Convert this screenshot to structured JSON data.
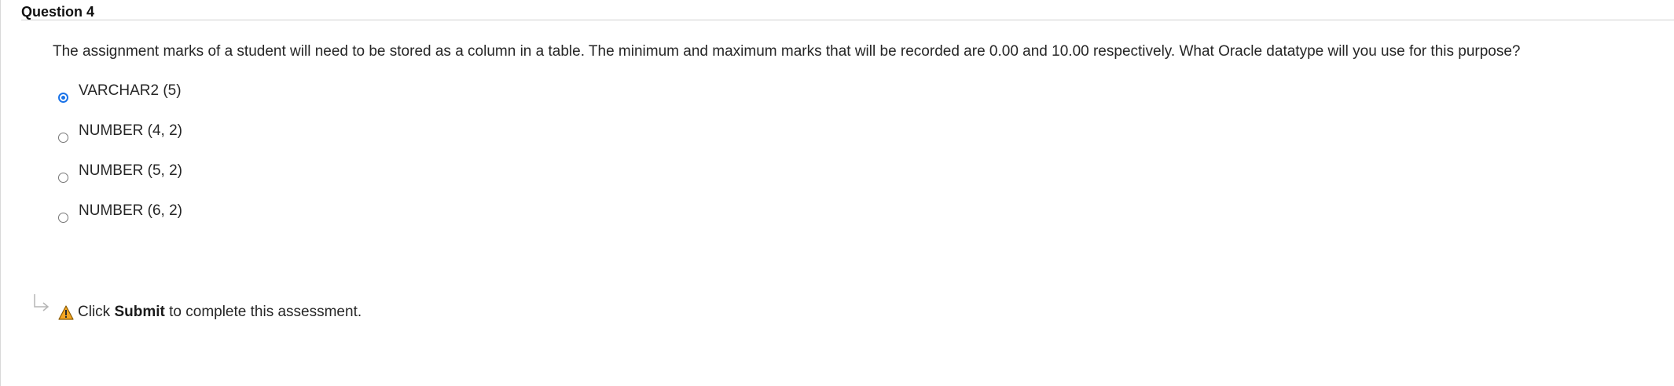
{
  "question": {
    "title": "Question 4",
    "text": "The assignment marks of a student will need to be stored as a column in a table. The minimum and maximum marks that will be recorded are 0.00 and 10.00 respectively.  What Oracle datatype will you use for this purpose?"
  },
  "options": [
    {
      "label": "VARCHAR2 (5)",
      "selected": true
    },
    {
      "label": "NUMBER (4, 2)",
      "selected": false
    },
    {
      "label": "NUMBER (5, 2)",
      "selected": false
    },
    {
      "label": "NUMBER (6, 2)",
      "selected": false
    }
  ],
  "footer": {
    "prefix": "Click",
    "action": "Submit",
    "suffix": "to complete this assessment."
  },
  "colors": {
    "selected_radio": "#1a73e8",
    "warning": "#f5a623"
  },
  "icons": {
    "arrow": "return-arrow-icon",
    "warning": "warning-icon"
  }
}
